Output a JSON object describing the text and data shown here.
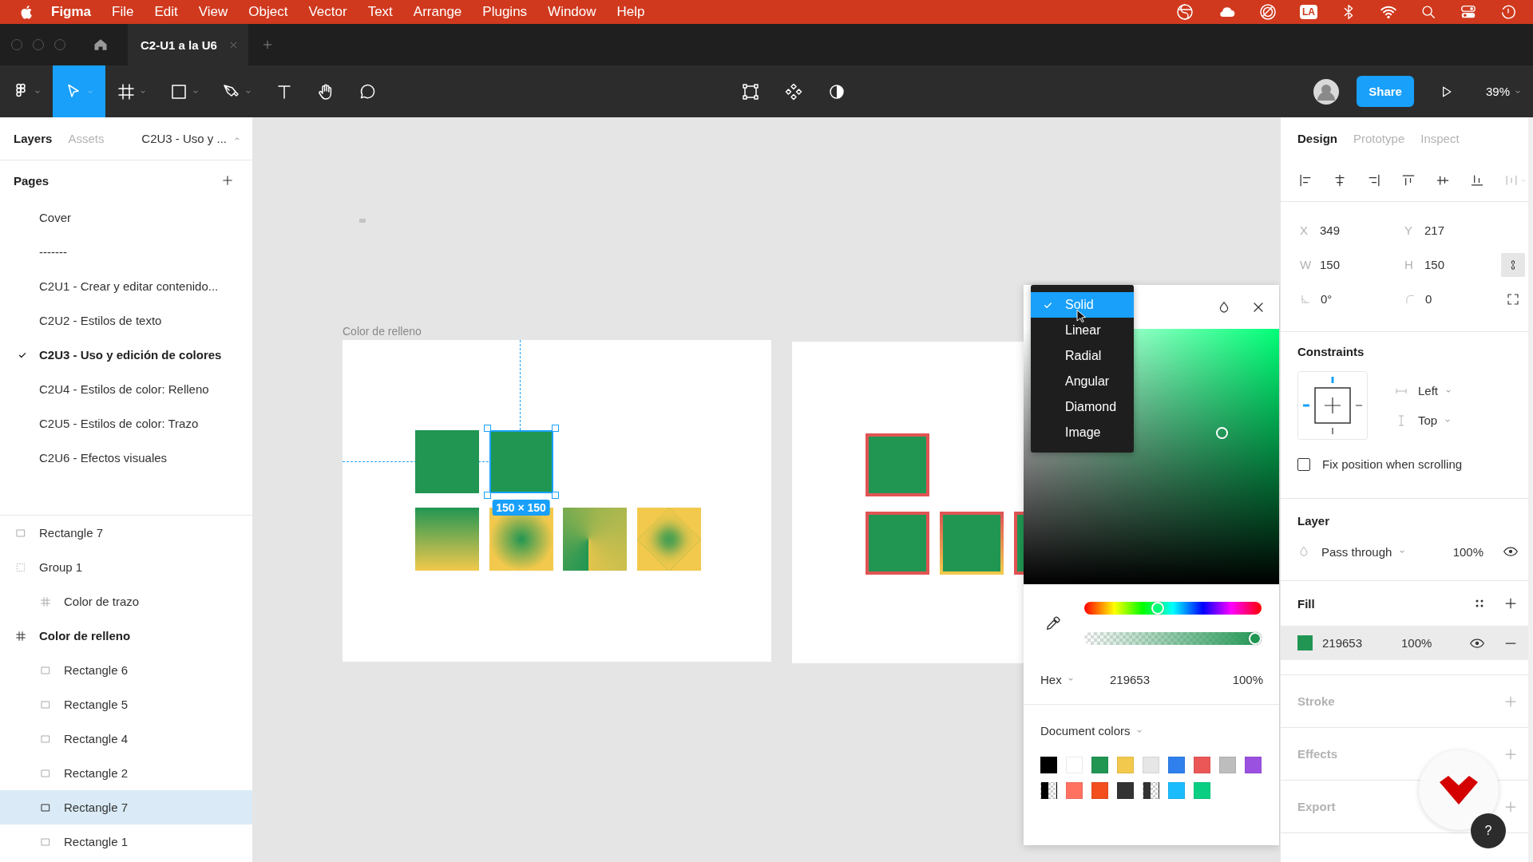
{
  "menubar": {
    "app_name": "Figma",
    "menus": [
      "File",
      "Edit",
      "View",
      "Object",
      "Vector",
      "Text",
      "Arrange",
      "Plugins",
      "Window",
      "Help"
    ],
    "input_source": "LA"
  },
  "tab_bar": {
    "tabs": [
      {
        "label": "C2-U1 a la U6",
        "selected": true
      }
    ]
  },
  "toolbar": {
    "tools": [
      {
        "kind": "main-menu",
        "selected": false
      },
      {
        "kind": "move",
        "selected": true
      },
      {
        "kind": "frame",
        "selected": false
      },
      {
        "kind": "shape",
        "selected": false
      },
      {
        "kind": "pen",
        "selected": false
      },
      {
        "kind": "text",
        "selected": false
      },
      {
        "kind": "hand",
        "selected": false
      },
      {
        "kind": "comment",
        "selected": false
      }
    ],
    "share": "Share",
    "zoom": "39%"
  },
  "left_panel": {
    "tabs": [
      {
        "label": "Layers",
        "selected": true
      },
      {
        "label": "Assets",
        "selected": false
      }
    ],
    "page_switcher": "C2U3 - Uso y ...",
    "pages_title": "Pages",
    "pages": [
      {
        "label": "Cover",
        "selected": false
      },
      {
        "label": "-------",
        "selected": false
      },
      {
        "label": "C2U1 - Crear y editar contenido...",
        "selected": false
      },
      {
        "label": "C2U2 - Estilos de texto",
        "selected": false
      },
      {
        "label": "C2U3 - Uso y edición de colores",
        "selected": true
      },
      {
        "label": "C2U4 - Estilos de color: Relleno",
        "selected": false
      },
      {
        "label": "C2U5 - Estilos de color: Trazo",
        "selected": false
      },
      {
        "label": "C2U6 - Efectos visuales",
        "selected": false
      }
    ],
    "layers": [
      {
        "label": "Rectangle 7",
        "kind": "rectangle",
        "selected": false
      },
      {
        "label": "Group 1",
        "kind": "group",
        "selected": false,
        "children": [
          {
            "label": "Color de trazo",
            "kind": "frame",
            "selected": false
          }
        ]
      },
      {
        "label": "Color de relleno",
        "kind": "frame",
        "selected": false,
        "children": [
          {
            "label": "Rectangle 6",
            "kind": "rectangle",
            "selected": false
          },
          {
            "label": "Rectangle 5",
            "kind": "rectangle",
            "selected": false
          },
          {
            "label": "Rectangle 4",
            "kind": "rectangle",
            "selected": false
          },
          {
            "label": "Rectangle 2",
            "kind": "rectangle",
            "selected": false
          },
          {
            "label": "Rectangle 7",
            "kind": "rectangle",
            "selected": true
          },
          {
            "label": "Rectangle 1",
            "kind": "rectangle",
            "selected": false
          }
        ]
      }
    ]
  },
  "canvas": {
    "size_label": "150 × 150",
    "frames": [
      {
        "title": "Color de relleno",
        "rows": [
          [
            {
              "kind": "solid",
              "selected": false
            },
            {
              "kind": "solid",
              "selected": true
            }
          ],
          [
            {
              "kind": "linear",
              "selected": false
            },
            {
              "kind": "radial",
              "selected": false
            },
            {
              "kind": "angular",
              "selected": false
            },
            {
              "kind": "diamond",
              "selected": false
            }
          ]
        ]
      },
      {
        "rows": [
          [
            {
              "kind": "red-stroke",
              "selected": false
            }
          ],
          [
            {
              "kind": "red-stroke",
              "selected": false
            },
            {
              "kind": "gradient-stroke",
              "selected": false
            },
            {
              "kind": "red-stroke",
              "selected": false
            }
          ]
        ]
      }
    ]
  },
  "color_picker": {
    "fill_types": [
      {
        "label": "Solid",
        "selected": true
      },
      {
        "label": "Linear",
        "selected": false
      },
      {
        "label": "Radial",
        "selected": false
      },
      {
        "label": "Angular",
        "selected": false
      },
      {
        "label": "Diamond",
        "selected": false
      },
      {
        "label": "Image",
        "selected": false
      }
    ],
    "hue": {
      "level": 0.41
    },
    "opacity": {
      "level": 1
    },
    "format": "Hex",
    "hex": "219653",
    "alpha": "100%",
    "library": "Document colors",
    "swatches": [
      {
        "kind": "solid",
        "color": "#000000"
      },
      {
        "kind": "solid",
        "color": "#ffffff"
      },
      {
        "kind": "solid",
        "color": "#219653"
      },
      {
        "kind": "solid",
        "color": "#f2c94c"
      },
      {
        "kind": "solid",
        "color": "#e6e6e6"
      },
      {
        "kind": "solid",
        "color": "#2f80ed"
      },
      {
        "kind": "solid",
        "color": "#eb5757"
      },
      {
        "kind": "solid",
        "color": "#bdbdbd"
      },
      {
        "kind": "solid",
        "color": "#9b51e0"
      },
      {
        "kind": "half-transparent",
        "color": "#000000"
      },
      {
        "kind": "solid",
        "color": "#ff7262"
      },
      {
        "kind": "solid",
        "color": "#f24e1e"
      },
      {
        "kind": "solid",
        "color": "#333333"
      },
      {
        "kind": "half-transparent",
        "color": "#333333"
      },
      {
        "kind": "solid",
        "color": "#1abcfe"
      },
      {
        "kind": "solid",
        "color": "#0acf83"
      }
    ]
  },
  "design_panel": {
    "tabs": [
      {
        "label": "Design",
        "selected": true
      },
      {
        "label": "Prototype",
        "selected": false
      },
      {
        "label": "Inspect",
        "selected": false
      }
    ],
    "fields": [
      {
        "kind": "text",
        "label": "X",
        "value": "349"
      },
      {
        "kind": "text",
        "label": "Y",
        "value": "217"
      },
      {
        "kind": "text",
        "label": "W",
        "value": "150"
      },
      {
        "kind": "text",
        "label": "H",
        "value": "150"
      },
      {
        "kind": "angle",
        "value": "0°"
      },
      {
        "kind": "corner",
        "value": "0"
      }
    ],
    "constraints": {
      "title": "Constraints",
      "horizontal": "Left",
      "vertical": "Top",
      "fix_position": {
        "label": "Fix position when scrolling",
        "checked": false
      }
    },
    "layer": {
      "title": "Layer",
      "blend": "Pass through",
      "opacity": "100%"
    },
    "fill": {
      "title": "Fill",
      "color": "#219653",
      "hex": "219653",
      "opacity": "100%"
    },
    "empty_sections": [
      "Stroke",
      "Effects",
      "Export"
    ]
  },
  "help": "?"
}
